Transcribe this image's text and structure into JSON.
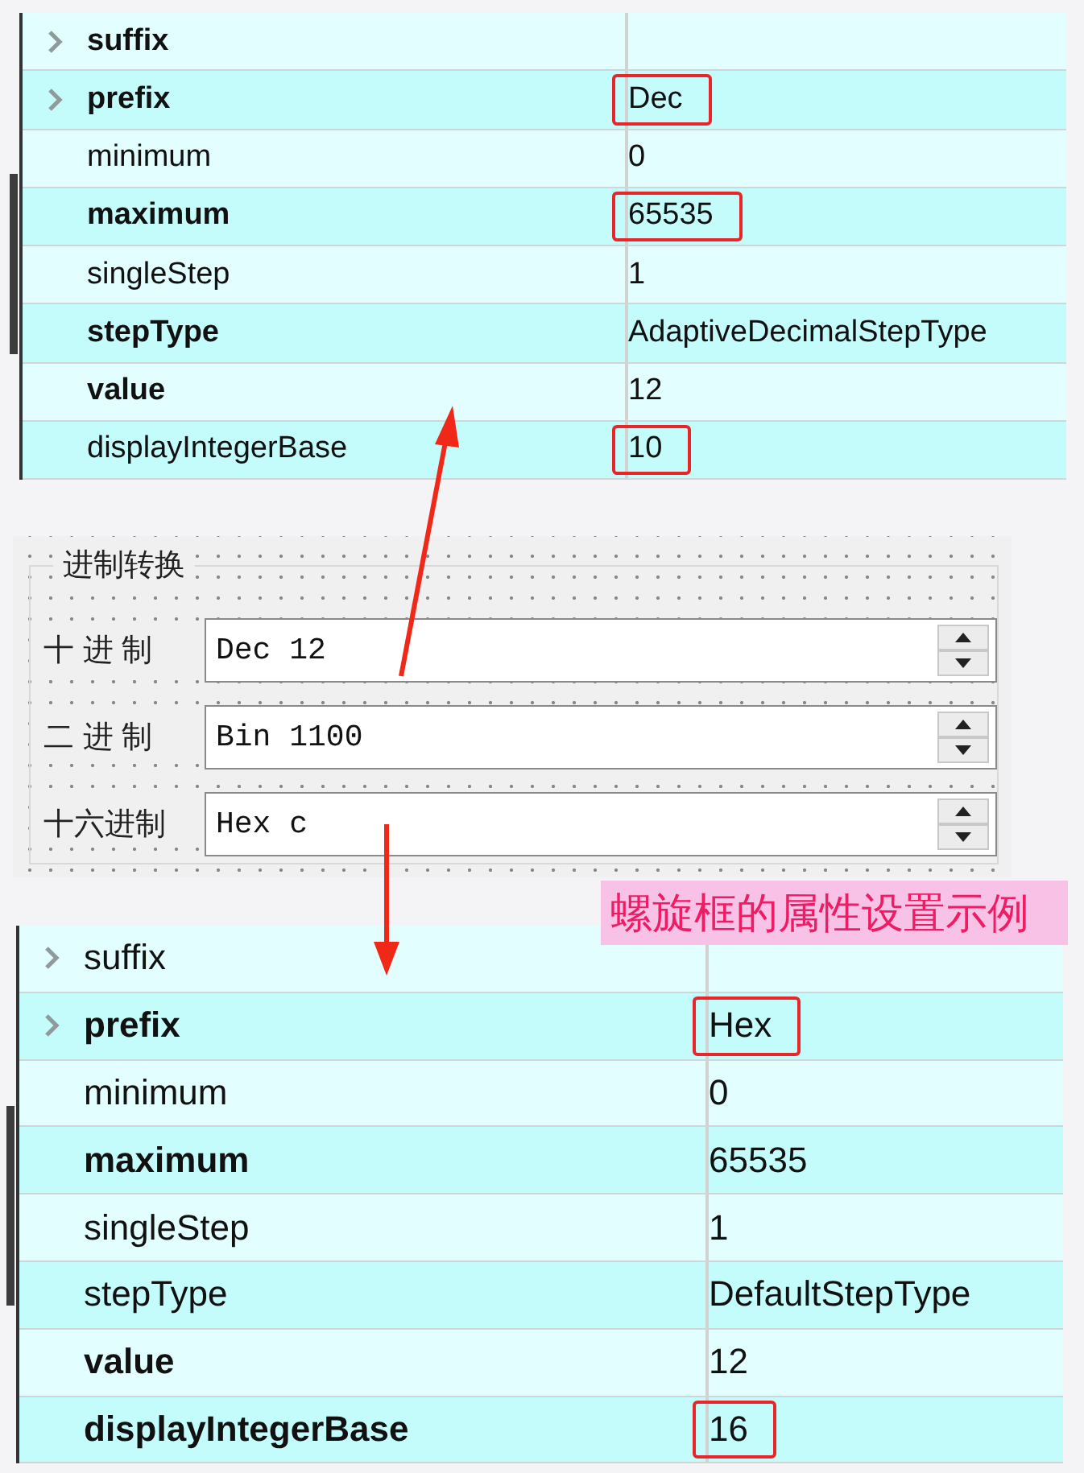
{
  "property_tables": [
    {
      "rows": [
        {
          "name": "suffix",
          "expandable": true,
          "modified": true
        },
        {
          "name": "prefix",
          "value": "Dec",
          "expandable": true,
          "modified": true,
          "highlighted": true
        },
        {
          "name": "minimum",
          "value": "0",
          "expandable": false,
          "modified": false,
          "highlighted": false
        },
        {
          "name": "maximum",
          "value": "65535",
          "expandable": false,
          "modified": true,
          "highlighted": true
        },
        {
          "name": "singleStep",
          "value": "1",
          "expandable": false,
          "modified": false,
          "highlighted": false
        },
        {
          "name": "stepType",
          "value": "AdaptiveDecimalStepType",
          "expandable": false,
          "modified": true,
          "highlighted": false
        },
        {
          "name": "value",
          "value": "12",
          "expandable": false,
          "modified": true,
          "highlighted": false
        },
        {
          "name": "displayIntegerBase",
          "value": "10",
          "expandable": false,
          "modified": false,
          "highlighted": true
        }
      ]
    },
    {
      "rows": [
        {
          "name": "suffix",
          "expandable": true,
          "modified": false
        },
        {
          "name": "prefix",
          "value": "Hex",
          "expandable": true,
          "modified": true,
          "highlighted": true
        },
        {
          "name": "minimum",
          "value": "0",
          "expandable": false,
          "modified": false,
          "highlighted": false
        },
        {
          "name": "maximum",
          "value": "65535",
          "expandable": false,
          "modified": true,
          "highlighted": false
        },
        {
          "name": "singleStep",
          "value": "1",
          "expandable": false,
          "modified": false,
          "highlighted": false
        },
        {
          "name": "stepType",
          "value": "DefaultStepType",
          "expandable": false,
          "modified": false,
          "highlighted": false
        },
        {
          "name": "value",
          "value": "12",
          "expandable": false,
          "modified": true,
          "highlighted": false
        },
        {
          "name": "displayIntegerBase",
          "value": "16",
          "expandable": false,
          "modified": true,
          "highlighted": true
        }
      ]
    }
  ],
  "group_box": {
    "title": "进制转换",
    "rows": [
      {
        "label": "十 进 制",
        "value": "Dec 12"
      },
      {
        "label": "二 进 制",
        "value": "Bin 1100"
      },
      {
        "label": "十六进制",
        "value": "Hex c"
      }
    ]
  },
  "caption": "螺旋框的属性设置示例"
}
